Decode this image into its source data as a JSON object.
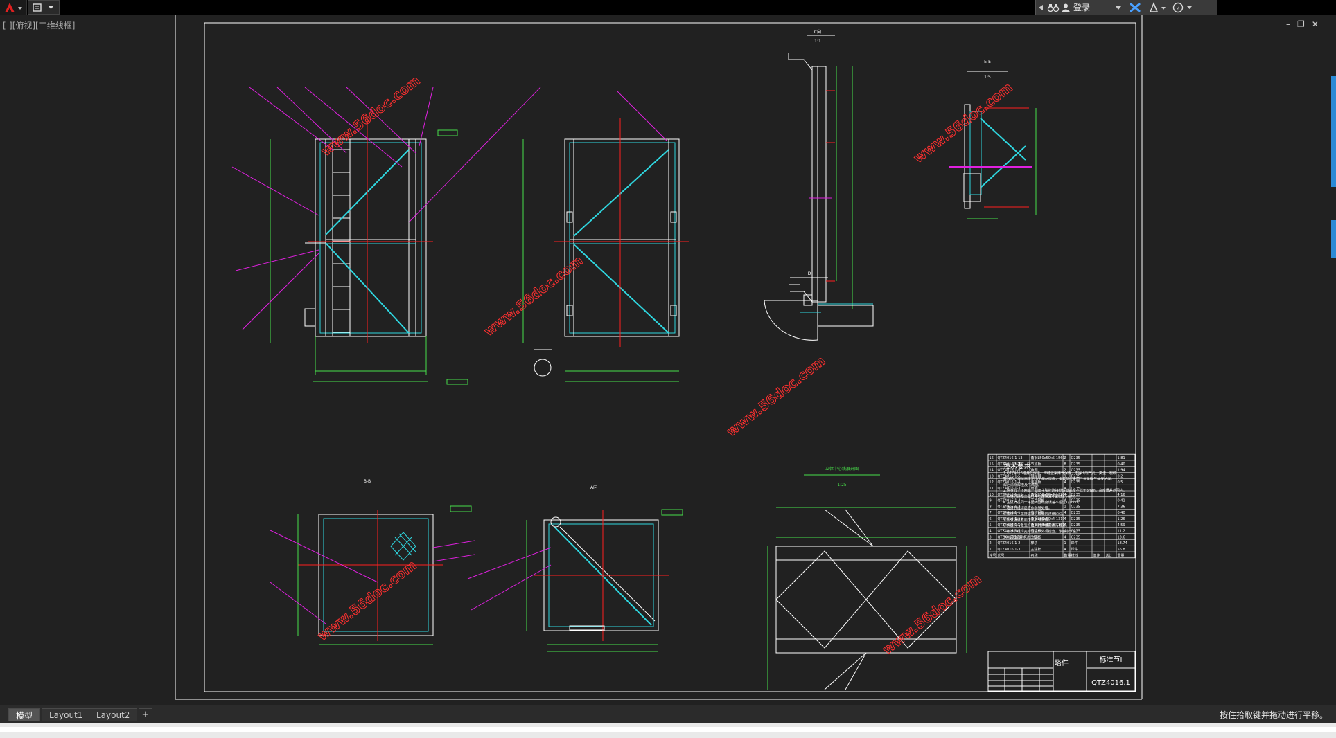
{
  "titlebar": {
    "app_icon": "autocad-logo-icon",
    "qat_icon": "quick-access-icon"
  },
  "infobar": {
    "login_label": "登录",
    "search_icon": "binoculars-icon",
    "user_icon": "user-icon",
    "exchange_icon": "x-exchange-icon",
    "a360_icon": "a360-icon",
    "help_icon": "help-icon"
  },
  "viewport": {
    "label": "[-][俯视][二维线框]"
  },
  "window_controls": {
    "minimize": "–",
    "restore": "❐",
    "close": "✕"
  },
  "drawing": {
    "watermark": "www.56doc.com",
    "tech_title": "技术要求",
    "tech_lines": [
      "1.QTZ4016塔身节焊接，焊缝应采用气保焊，不得出现气孔、夹渣、裂纹",
      "等缺陷，焊缝高度不小于母材厚度，重要部位采用二氧化碳气体保护焊。",
      "焊后清除焊渣及飞溅物。",
      "2.塔身节上下两端，四角主弦杆连接处焊缝高度不低于8mm，高度误差范围内。",
      "3.标准节四根主弦杆中心距误差不超过1.5mm。",
      "4.主弦杆在同一平面内直线度误差不超过1/1000。",
      "5.塔身节组焊后应作防锈处理。",
      "6.腹杆与主弦杆焊接，焊缝应连续均匀。",
      "7.所有焊缝表面不允许有裂纹。",
      "8.斜腹杆与主弦杆之间的焊缝应进行检查。",
      "9.标准节组焊完毕后应作外观检查，涂底漆一遍。",
      "10.按图纸要求进行标注。"
    ],
    "title_block": {
      "part_name": "标准节Ⅰ",
      "doc_no": "QTZ4016.1",
      "material_label": "塔件"
    },
    "bom_rows": [
      [
        "16",
        "QTZ4016.1-13",
        "角钢L50x50x5-1560",
        "2",
        "Q235",
        "",
        "",
        "1.81"
      ],
      [
        "15",
        "QTZ4016.1-7",
        "节点板",
        "8",
        "Q235",
        "",
        "",
        "0.40"
      ],
      [
        "14",
        "QTZ4016.1-6",
        "角钢",
        "2",
        "Q235",
        "",
        "",
        "1.94"
      ],
      [
        "13",
        "QTZ4016.1-5",
        "钢丝网",
        "1",
        "Q235",
        "",
        "",
        "0.2"
      ],
      [
        "12",
        "QTZ4016.1-4",
        "连接板",
        "4",
        "Q235",
        "",
        "",
        "0.5"
      ],
      [
        "11",
        "QTZ4016.1-3",
        "角钢",
        "4",
        "Q235",
        "",
        "",
        ""
      ],
      [
        "10",
        "QTZ4016.1-11",
        "角钢L50x50x4-1390",
        "4",
        "Q235",
        "",
        "",
        "4.16"
      ],
      [
        "9",
        "QTZ4016.1-4",
        "节点钢板",
        "4",
        "Q235",
        "",
        "",
        "0.41"
      ],
      [
        "8",
        "QTZ4016.1-2",
        "",
        "1",
        "Q235",
        "",
        "",
        "7.36"
      ],
      [
        "7",
        "QTZ4016.1-1",
        "节点钢板",
        "4",
        "Q235",
        "",
        "",
        "0.40"
      ],
      [
        "6",
        "QTZ4016.1-11",
        "角钢L50x50x4-1310",
        "4",
        "Q235",
        "",
        "",
        "1.26"
      ],
      [
        "5",
        "QTZ4016.1-10",
        "角钢L63x63x5-1370",
        "4",
        "Q235",
        "",
        "",
        "4.59"
      ],
      [
        "4",
        "QTZ4016.1-1",
        "节点板",
        "4",
        "Q235",
        "",
        "",
        "11.2"
      ],
      [
        "3",
        "QTZ4016.1-1",
        "主弦杆",
        "4",
        "Q235",
        "",
        "",
        "13.6"
      ],
      [
        "2",
        "QTZ4016.1-2",
        "梯子",
        "1",
        "焊件",
        "",
        "",
        "18.74"
      ],
      [
        "1",
        "QTZ4016.1-3",
        "主弦杆",
        "4",
        "焊件",
        "",
        "",
        "56.8"
      ]
    ],
    "bom_header": [
      "序号",
      "代号",
      "名称",
      "数量",
      "材料",
      "单件",
      "总计",
      "重量"
    ],
    "view_labels": {
      "top_right": "C向",
      "scale_1": "1:1",
      "scale_2": "1:5",
      "section_e": "E-E",
      "view_d": "D",
      "section_b": "B-B",
      "view_a": "A向",
      "layout_title": "立体中心线展开图",
      "scale_25": "1:25"
    }
  },
  "tabs": [
    {
      "label": "模型",
      "active": true
    },
    {
      "label": "Layout1",
      "active": false
    },
    {
      "label": "Layout2",
      "active": false
    }
  ],
  "tab_add": "+",
  "status": {
    "text": "按住拾取键并拖动进行平移。"
  },
  "colors": {
    "background": "#212121",
    "frame": "#ffffff",
    "green": "#48e04a",
    "cyan": "#2fd7e0",
    "red": "#ff2020",
    "magenta": "#e020e0",
    "watermark": "#ff3030"
  }
}
